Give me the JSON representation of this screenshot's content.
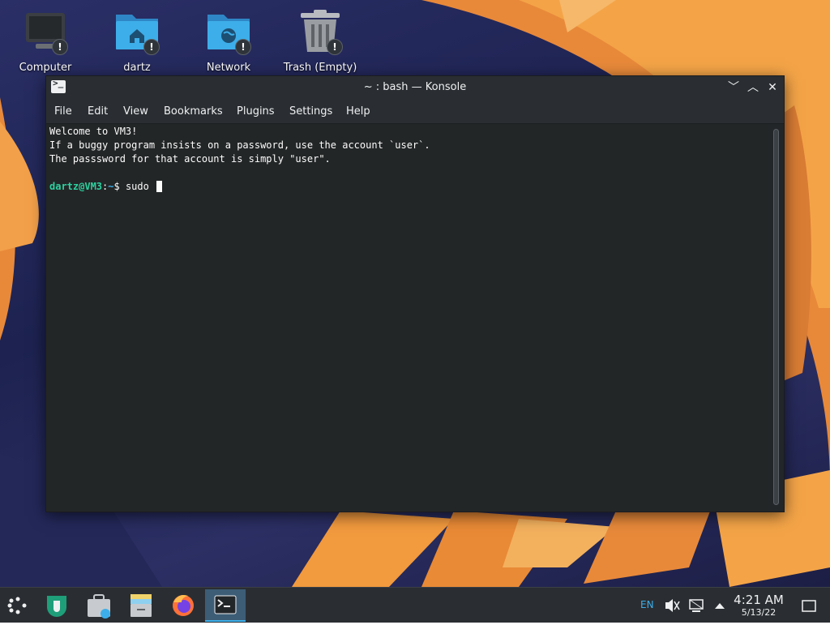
{
  "desktop": {
    "icons": [
      {
        "label": "Computer"
      },
      {
        "label": "dartz"
      },
      {
        "label": "Network"
      },
      {
        "label": "Trash (Empty)"
      }
    ],
    "badge_glyph": "!"
  },
  "window": {
    "title": "~ : bash — Konsole",
    "app_icon_glyph": ">_",
    "controls": {
      "minimize": "﹀",
      "maximize": "︿",
      "close": "✕"
    },
    "menu": [
      "File",
      "Edit",
      "View",
      "Bookmarks",
      "Plugins",
      "Settings",
      "Help"
    ]
  },
  "terminal": {
    "lines": [
      "Welcome to VM3!",
      "If a buggy program insists on a password, use the account `user`.",
      "The passsword for that account is simply \"user\"."
    ],
    "prompt_user": "dartz@VM3",
    "prompt_sep": ":",
    "prompt_path": "~",
    "prompt_symbol": "$ ",
    "command": "sudo "
  },
  "taskbar": {
    "icons": [
      "launcher-icon",
      "discover-icon",
      "store-icon",
      "file-manager-icon",
      "firefox-icon",
      "konsole-icon"
    ],
    "tray": {
      "lang": "EN",
      "time": "4:21 AM",
      "date": "5/13/22"
    }
  },
  "colors": {
    "accent": "#3daee9",
    "prompt_user": "#2cd3a0",
    "folder": "#3daee9",
    "wallpaper_orange": "#f0923b"
  }
}
